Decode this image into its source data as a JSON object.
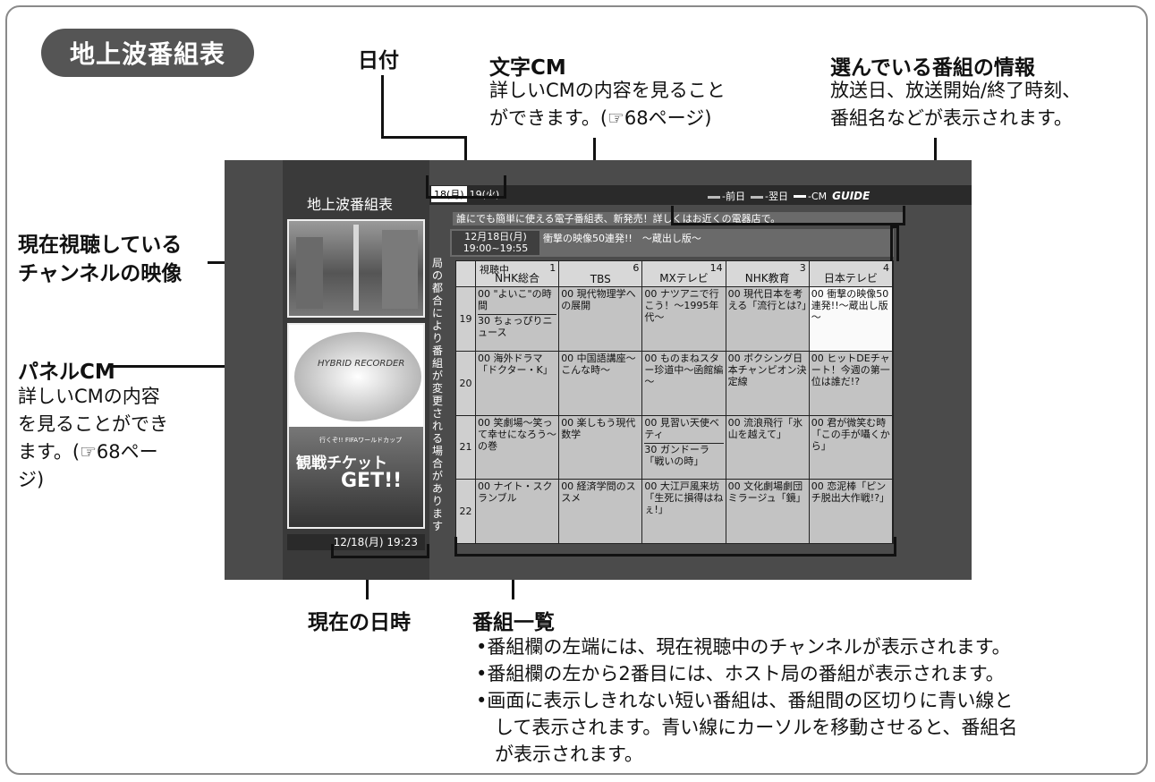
{
  "page_title": "地上波番組表",
  "callouts": {
    "date": "日付",
    "text_cm_head": "文字CM",
    "text_cm_lines": [
      "詳しいCMの内容を見ること",
      "ができます。(☞68ページ)"
    ],
    "info_head": "選んでいる番組の情報",
    "info_lines": [
      "放送日、放送開始/終了時刻、",
      "番組名などが表示されます。"
    ],
    "current_video_lines": [
      "現在視聴している",
      "チャンネルの映像"
    ],
    "panel_cm_head": "パネルCM",
    "panel_cm_lines": [
      "詳しいCMの内容",
      "を見ることができ",
      "ます。(☞68ペー",
      "ジ)"
    ],
    "now_time": "現在の日時",
    "program_list_head": "番組一覧",
    "program_list_bullets": [
      "•番組欄の左端には、現在視聴中のチャンネルが表示されます。",
      "•番組欄の左から2番目には、ホスト局の番組が表示されます。",
      "•画面に表示しきれない短い番組は、番組間の区切りに青い線と",
      "　して表示されます。青い線にカーソルを移動させると、番組名",
      "　が表示されます。"
    ]
  },
  "screen": {
    "title": "地上波番組表",
    "date_tabs": [
      "18(月)",
      "19(火)"
    ],
    "legend": [
      "-前日",
      "-翌日",
      "-CM",
      "GUIDE"
    ],
    "cm_text": "誰にでも簡単に使える電子番組表、新発売！詳しくはお近くの電器店で。",
    "info_date": "12月18日(月)",
    "info_time": "19:00~19:55",
    "info_name": "衝撃の映像50連発!!　～蔵出し版～",
    "vertical_note": "局の都合により番組が変更される場合があります",
    "clock": "12/18(月) 19:23",
    "panel_cm_text1": "HYBRID RECORDER",
    "panel_cm_text2": "行くぞ!! FIFAワールドカップ",
    "panel_cm_text3": "観戦チケット",
    "panel_cm_text4": "GET!!",
    "viewing_label": "視聴中",
    "channels": [
      {
        "num": "1",
        "name": "NHK総合"
      },
      {
        "num": "6",
        "name": "TBS"
      },
      {
        "num": "14",
        "name": "MXテレビ"
      },
      {
        "num": "3",
        "name": "NHK教育"
      },
      {
        "num": "4",
        "name": "日本テレビ"
      }
    ],
    "hours": [
      "19",
      "20",
      "21",
      "22"
    ],
    "programs": [
      [
        "00 \"よいこ\"の時間",
        "30 ちょっぴりニュース"
      ],
      [
        "00 現代物理学への展開"
      ],
      [
        "00 ナツアニで行こう！～1995年代～"
      ],
      [
        "00 現代日本を考える「流行とは?」"
      ],
      [
        "00 衝撃の映像50連発!!～蔵出し版～"
      ],
      [
        "00 海外ドラマ「ドクター・K」"
      ],
      [
        "00 中国語講座～こんな時～"
      ],
      [
        "00 ものまねスター珍道中～函館編～"
      ],
      [
        "00 ボクシング日本チャンピオン決定線"
      ],
      [
        "00 ヒットDEチャート！今週の第一位は誰だ!?"
      ],
      [
        "00 笑劇場～笑って幸せになろう～の巻"
      ],
      [
        "00 楽しもう現代数学"
      ],
      [
        "00 見習い天使ベティ",
        "30 ガンドーラ「戦いの時」"
      ],
      [
        "00 流浪飛行「氷山を越えて」"
      ],
      [
        "00 君が微笑む時「この手が囁くから」"
      ],
      [
        "00 ナイト・スクランブル"
      ],
      [
        "00 経済学問のススメ"
      ],
      [
        "00 大江戸風来坊「生死に損得はねぇ!」"
      ],
      [
        "00 文化劇場劇団ミラージュ「鏡」"
      ],
      [
        "00 恋泥棒「ピンチ脱出大作戦!?」"
      ]
    ]
  }
}
